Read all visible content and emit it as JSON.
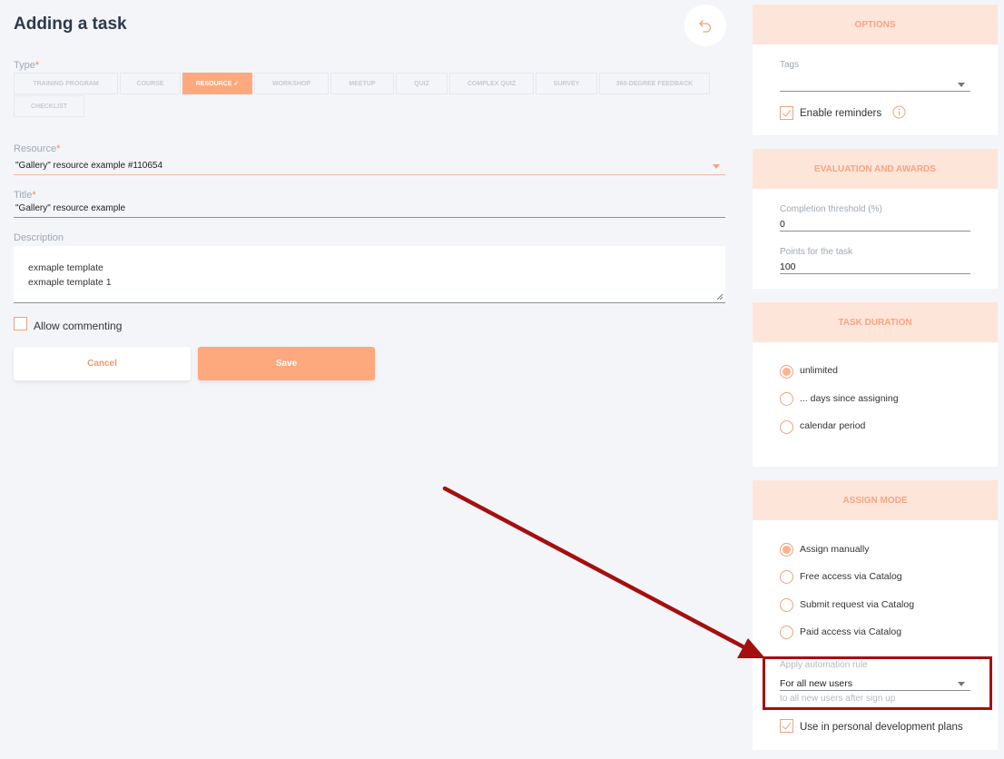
{
  "header": {
    "title": "Adding a task",
    "back_icon": "undo-arrow-icon"
  },
  "type": {
    "label": "Type",
    "required_mark": "*",
    "options": [
      "TRAINING PROGRAM",
      "COURSE",
      "RESOURCE ✓",
      "WORKSHOP",
      "MEETUP",
      "QUIZ",
      "COMPLEX QUIZ",
      "SURVEY",
      "360-DEGREE FEEDBACK",
      "CHECKLIST"
    ],
    "selected": "RESOURCE"
  },
  "resource": {
    "label": "Resource",
    "required_mark": "*",
    "value": "\"Gallery\" resource example #110654"
  },
  "title_field": {
    "label": "Title",
    "required_mark": "*",
    "value": "\"Gallery\" resource example"
  },
  "description": {
    "label": "Description",
    "line1": "exmaple template",
    "line2": "exmaple template 1"
  },
  "allow_commenting": {
    "label": "Allow commenting",
    "checked": false
  },
  "buttons": {
    "cancel": "Cancel",
    "save": "Save"
  },
  "options_panel": {
    "heading": "OPTIONS",
    "tags_label": "Tags",
    "tags_value": "",
    "enable_reminders_label": "Enable reminders",
    "enable_reminders_checked": true,
    "info_icon": "info-icon"
  },
  "evaluation_panel": {
    "heading": "EVALUATION AND AWARDS",
    "threshold_label": "Completion threshold (%)",
    "threshold_value": "0",
    "points_label": "Points for the task",
    "points_value": "100"
  },
  "duration_panel": {
    "heading": "TASK DURATION",
    "options": [
      "unlimited",
      "... days since assigning",
      "calendar period"
    ],
    "selected": "unlimited"
  },
  "assign_panel": {
    "heading": "ASSIGN MODE",
    "options": [
      "Assign manually",
      "Free access via Catalog",
      "Submit request via Catalog",
      "Paid access via Catalog"
    ],
    "selected": "Assign manually",
    "automation_label": "Apply automation rule",
    "automation_value": "For all new users",
    "automation_hint": "to all new users after sign up",
    "pdp_label": "Use in personal development plans",
    "pdp_checked": true
  },
  "colors": {
    "accent": "#fda87d",
    "panel_header_bg": "#fee5d9",
    "annotation_red": "#a50f0f",
    "background": "#f4f5f9"
  }
}
